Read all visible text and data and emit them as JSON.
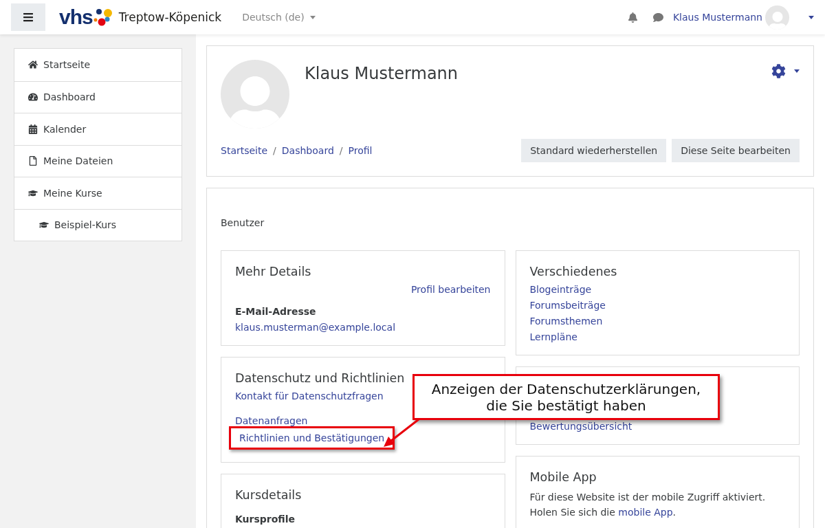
{
  "topbar": {
    "logo_text": "vhs",
    "site_name": "Treptow-Köpenick",
    "language": "Deutsch (de)",
    "user_name": "Klaus Mustermann"
  },
  "nav": [
    {
      "label": "Startseite"
    },
    {
      "label": "Dashboard"
    },
    {
      "label": "Kalender"
    },
    {
      "label": "Meine Dateien"
    },
    {
      "label": "Meine Kurse",
      "children": [
        {
          "label": "Beispiel-Kurs"
        }
      ]
    }
  ],
  "profile": {
    "name": "Klaus Mustermann",
    "breadcrumb": [
      "Startseite",
      "Dashboard",
      "Profil"
    ],
    "breadcrumb_separators": [
      "/",
      "/"
    ],
    "buttons": [
      "Standard wiederherstellen",
      "Diese Seite bearbeiten"
    ]
  },
  "section_title": "Benutzer",
  "columns": [
    [
      {
        "title": "Mehr Details",
        "groups": [
          [
            {
              "kind": "action",
              "text": "Profil bearbeiten"
            },
            {
              "kind": "label",
              "text": "E-Mail-Adresse"
            },
            {
              "kind": "link",
              "text": "klaus.musterman@example.local",
              "highlighted": false
            }
          ]
        ]
      },
      {
        "title": "Datenschutz und Richtlinien",
        "groups": [
          [
            {
              "kind": "link",
              "text": "Kontakt für Datenschutzfragen",
              "highlighted": false
            }
          ],
          [
            {
              "kind": "link",
              "text": "Datenanfragen",
              "highlighted": false
            },
            {
              "kind": "link",
              "text": "Richtlinien und Bestätigungen",
              "highlighted": true
            }
          ]
        ]
      },
      {
        "title": "Kursdetails",
        "groups": [
          [
            {
              "kind": "label",
              "text": "Kursprofile"
            }
          ]
        ]
      }
    ],
    [
      {
        "title": "Verschiedenes",
        "groups": [
          [
            {
              "kind": "link",
              "text": "Blogeinträge",
              "highlighted": false
            },
            {
              "kind": "link",
              "text": "Forumsbeiträge",
              "highlighted": false
            },
            {
              "kind": "link",
              "text": "Forumsthemen",
              "highlighted": false
            },
            {
              "kind": "link",
              "text": "Lernpläne",
              "highlighted": false
            }
          ]
        ]
      },
      {
        "groups": [
          [
            {
              "kind": "link",
              "text": "Bewertungsübersicht",
              "highlighted": false
            }
          ]
        ]
      },
      {
        "title": "Mobile App",
        "groups": [
          [
            {
              "kind": "paragraph",
              "text": "Für diese Website ist der mobile Zugriff aktiviert. Holen Sie sich die",
              "link": "mobile App",
              "after": "."
            }
          ]
        ]
      }
    ]
  ],
  "callout": {
    "lines": [
      "Anzeigen der Datenschutzerklärungen,",
      "die Sie bestätigt haben"
    ]
  }
}
